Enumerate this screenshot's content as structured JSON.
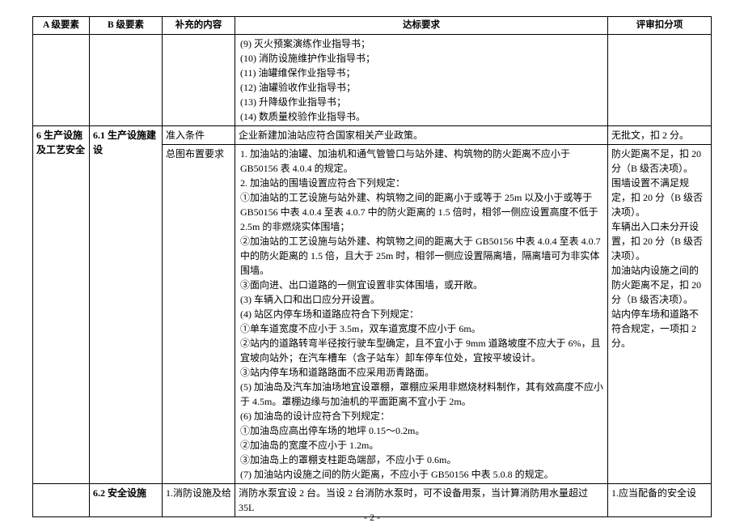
{
  "headers": {
    "a": "A 级要素",
    "b": "B 级要素",
    "c": "补充的内容",
    "d": "达标要求",
    "e": "评审扣分项"
  },
  "rows": [
    {
      "a": "",
      "b": "",
      "c": "",
      "d": "(9) 灭火预案演练作业指导书；\n(10) 消防设施维护作业指导书；\n(11) 油罐维保作业指导书；\n(12) 油罐验收作业指导书；\n(13) 升降级作业指导书；\n(14) 数质量校验作业指导书。",
      "e": ""
    },
    {
      "a": "6 生产设施及工艺安全",
      "b": "6.1 生产设施建设",
      "c": "准入条件",
      "d": "企业新建加油站应符合国家相关产业政策。",
      "e": "无批文，扣 2 分。"
    },
    {
      "a": "",
      "b": "",
      "c": "总图布置要求",
      "d": "1. 加油站的油罐、加油机和通气管管口与站外建、构筑物的防火距离不应小于 GB50156 表 4.0.4 的规定。\n2. 加油站的围墙设置应符合下列规定：\n①加油站的工艺设施与站外建、构筑物之间的距离小于或等于 25m 以及小于或等于 GB50156 中表 4.0.4 至表 4.0.7 中的防火距离的 1.5 倍时，相邻一侧应设置高度不低于 2.5m 的非燃烧实体围墙；\n②加油站的工艺设施与站外建、构筑物之间的距离大于 GB50156 中表 4.0.4 至表 4.0.7 中的防火距离的 1.5 倍，且大于 25m 时，相邻一侧应设置隔离墙，隔离墙可为非实体围墙。\n③面向进、出口道路的一侧宜设置非实体围墙，或开敞。\n(3) 车辆入口和出口应分开设置。\n(4) 站区内停车场和道路应符合下列规定：\n①单车道宽度不应小于 3.5m，双车道宽度不应小于 6m。\n②站内的道路转弯半径按行驶车型确定，且不宜小于 9mm 道路坡度不应大于 6%，且宜坡向站外；在汽车槽车（含子站车）卸车停车位处，宜按平坡设计。\n③站内停车场和道路路面不应采用沥青路面。\n(5) 加油岛及汽车加油场地宜设罩棚，罩棚应采用非燃烧材料制作，其有效高度不应小于 4.5m。罩棚边缘与加油机的平面距离不宜小于 2m。\n(6) 加油岛的设计应符合下列规定：\n①加油岛应高出停车场的地坪 0.15～0.2m。\n②加油岛的宽度不应小于 1.2m。\n③加油岛上的罩棚支柱距岛端部，不应小于 0.6m。\n(7) 加油站内设施之间的防火距离，不应小于 GB50156 中表 5.0.8 的规定。",
      "e_bold": "防火距离不足，扣 20 分（B 级否决项）。\n围墙设置不满足规定，扣 20 分（B 级否决项）。\n车辆出入口未分开设置，扣 20 分（B 级否决项）。\n加油站内设施之间的防火距离不足，扣 20 分（B 级否决项）。",
      "e_normal": "站内停车场和道路不符合规定，一项扣 2 分。"
    },
    {
      "a": "",
      "b": "6.2 安全设施",
      "c": "1.消防设施及给",
      "d": "消防水泵宜设 2 台。当设 2 台消防水泵时，可不设备用泵，当计算消防用水量超过 35L",
      "e": "1.应当配备的安全设"
    }
  ],
  "footer": "- 2 -"
}
